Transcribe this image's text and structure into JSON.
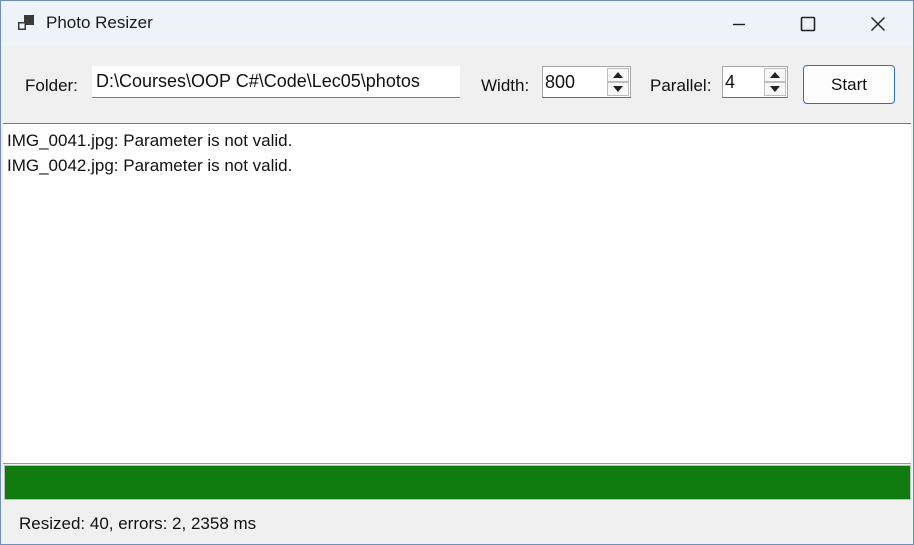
{
  "window": {
    "title": "Photo Resizer"
  },
  "toolbar": {
    "folder_label": "Folder:",
    "folder_value": "D:\\Courses\\OOP C#\\Code\\Lec05\\photos",
    "width_label": "Width:",
    "width_value": "800",
    "parallel_label": "Parallel:",
    "parallel_value": "4",
    "start_label": "Start"
  },
  "log": {
    "lines": [
      "IMG_0041.jpg: Parameter is not valid.",
      "IMG_0042.jpg: Parameter is not valid."
    ]
  },
  "progress": {
    "value_percent": 100,
    "color": "#0f7b0f"
  },
  "status": {
    "text": "Resized: 40, errors: 2, 2358 ms"
  },
  "icons": {
    "app": "app-window-icon",
    "minimize": "minimize-icon",
    "maximize": "maximize-icon",
    "close": "close-icon",
    "spin_up": "chevron-up-icon",
    "spin_down": "chevron-down-icon"
  }
}
